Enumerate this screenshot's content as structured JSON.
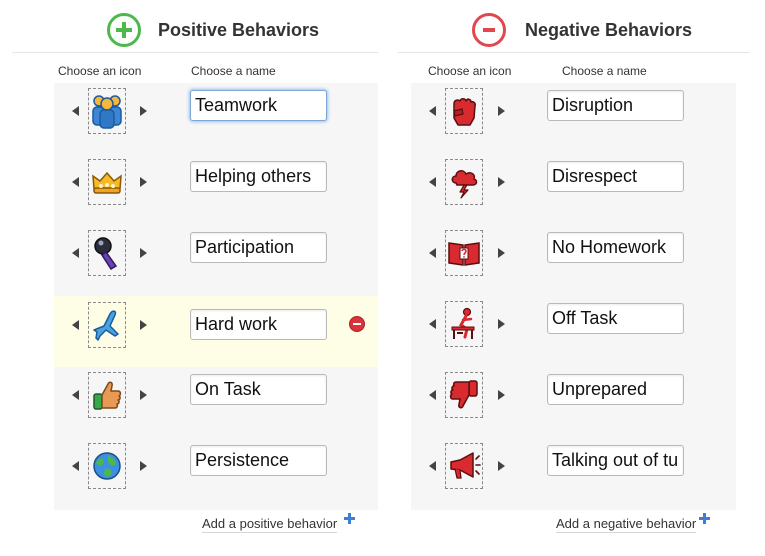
{
  "positive": {
    "title": "Positive Behaviors",
    "col_icon": "Choose an icon",
    "col_name": "Choose a name",
    "add_label": "Add a positive behavior",
    "accent": "#4cba4a",
    "items": [
      {
        "name": "Teamwork",
        "icon": "teamwork-people-icon"
      },
      {
        "name": "Helping others",
        "icon": "crown-icon"
      },
      {
        "name": "Participation",
        "icon": "microphone-icon"
      },
      {
        "name": "Hard work",
        "icon": "airplane-icon"
      },
      {
        "name": "On Task",
        "icon": "thumbs-up-icon"
      },
      {
        "name": "Persistence",
        "icon": "globe-icon"
      }
    ]
  },
  "negative": {
    "title": "Negative Behaviors",
    "col_icon": "Choose an icon",
    "col_name": "Choose a name",
    "add_label": "Add a negative behavior",
    "accent": "#e0474f",
    "items": [
      {
        "name": "Disruption",
        "icon": "fist-icon"
      },
      {
        "name": "Disrespect",
        "icon": "storm-cloud-icon"
      },
      {
        "name": "No Homework",
        "icon": "question-book-icon"
      },
      {
        "name": "Off Task",
        "icon": "person-at-desk-icon"
      },
      {
        "name": "Unprepared",
        "icon": "thumbs-down-icon"
      },
      {
        "name": "Talking out of turn",
        "icon": "megaphone-icon"
      }
    ]
  }
}
